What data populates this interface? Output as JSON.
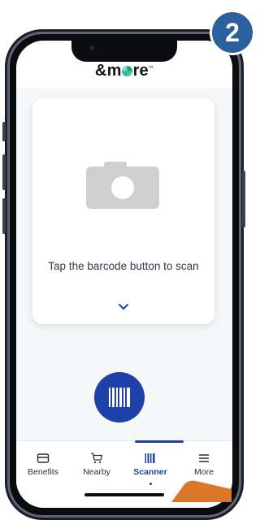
{
  "step_badge": "2",
  "app": {
    "logo_prefix": "&m",
    "logo_suffix": "re",
    "logo_tm": "™"
  },
  "scanner": {
    "message": "Tap the barcode button to scan",
    "camera_icon": "camera-icon",
    "chevron_icon": "chevron-down-icon",
    "barcode_icon": "barcode-icon"
  },
  "nav": {
    "items": [
      {
        "label": "Benefits",
        "icon": "card-icon"
      },
      {
        "label": "Nearby",
        "icon": "cart-icon"
      },
      {
        "label": "Scanner",
        "icon": "barcode-icon"
      },
      {
        "label": "More",
        "icon": "menu-icon"
      }
    ],
    "active": "Scanner"
  },
  "colors": {
    "accent": "#1e40a9",
    "badge": "#2c5f9e",
    "pointer": "#d9782a"
  }
}
